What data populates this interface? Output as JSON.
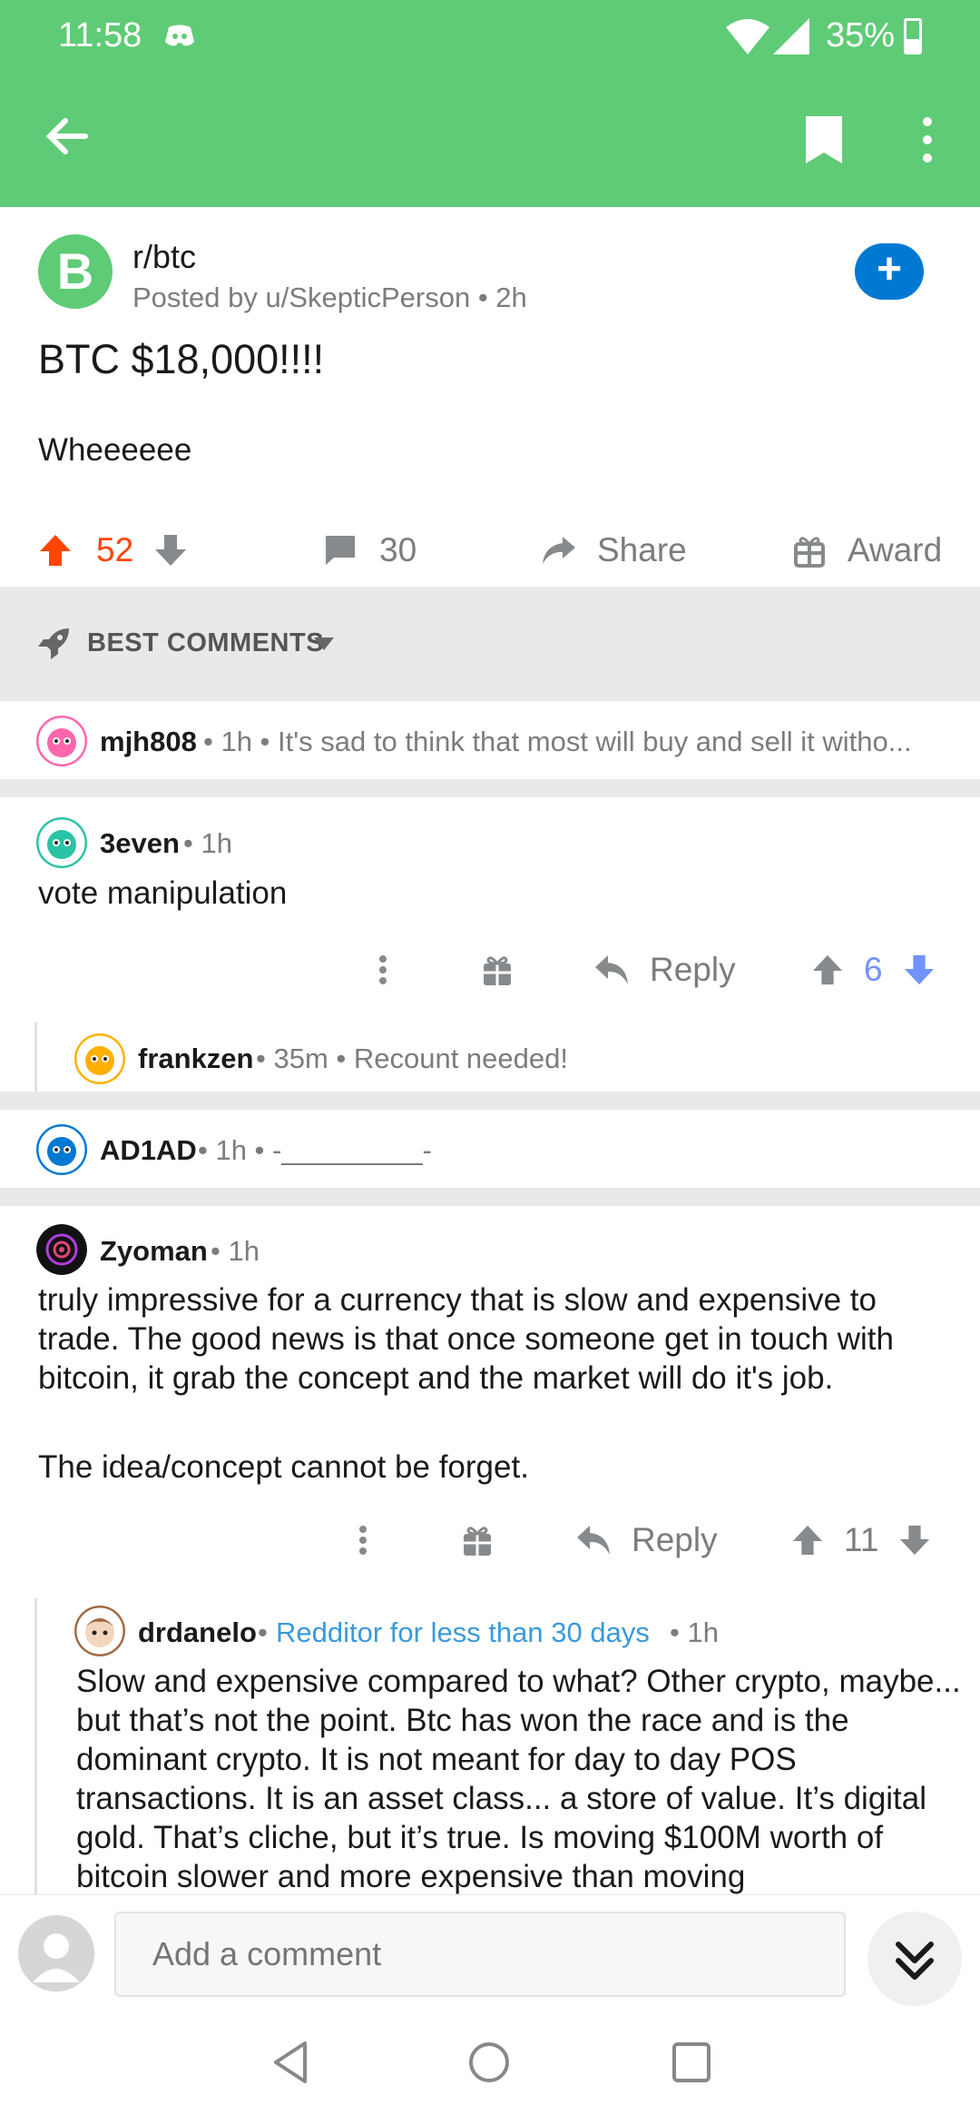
{
  "status_bar": {
    "time": "11:58",
    "battery": "35%"
  },
  "post": {
    "subreddit": "r/btc",
    "sub_icon_letter": "B",
    "posted_by": "Posted by u/SkepticPerson • 2h",
    "title": "BTC $18,000!!!!",
    "body": "Wheeeeee",
    "score": "52",
    "comments": "30",
    "share_label": "Share",
    "award_label": "Award"
  },
  "sort": {
    "label": "BEST COMMENTS"
  },
  "comments": [
    {
      "user": "mjh808",
      "meta": "• 1h • It's sad to think that most will buy and sell it witho..."
    },
    {
      "user": "3even",
      "meta": "• 1h",
      "text": "vote manipulation",
      "reply_label": "Reply",
      "score": "6"
    },
    {
      "user": "frankzen",
      "meta": "• 35m • Recount needed!"
    },
    {
      "user": "AD1AD",
      "meta": "• 1h • -_________-"
    },
    {
      "user": "Zyoman",
      "meta": "• 1h",
      "text_p1": "truly impressive for a currency that is slow and expensive to trade. The good news is that once someone get in touch with bitcoin, it grab the concept and the market will do it's job.",
      "text_p2": "The idea/concept cannot be forget.",
      "reply_label": "Reply",
      "score": "11"
    },
    {
      "user": "drdanelo",
      "flair": "Redditor for less than 30 days",
      "meta": "• 1h",
      "text": "Slow and expensive compared to what?     Other crypto, maybe...  but that’s not the point.  Btc has won the race and is the dominant crypto.   It is not meant for day to day POS transactions.  It is an asset class...  a store of value.   It’s digital gold.   That’s cliche, but it’s true.    Is moving $100M worth of bitcoin slower and more expensive than moving"
    }
  ],
  "composer": {
    "placeholder": "Add a comment"
  },
  "colors": {
    "header_green": "#5fcb76",
    "upvote_orange": "#ff4500",
    "vote_blue": "#7193ff",
    "join_blue": "#0079d3",
    "flair_blue": "#3a9ad9"
  },
  "icons": [
    "back-arrow-icon",
    "bookmark-icon",
    "more-vertical-icon",
    "upvote-icon",
    "downvote-icon",
    "comment-icon",
    "share-icon",
    "gift-icon",
    "rocket-icon",
    "reply-icon",
    "chevron-double-down-icon"
  ]
}
